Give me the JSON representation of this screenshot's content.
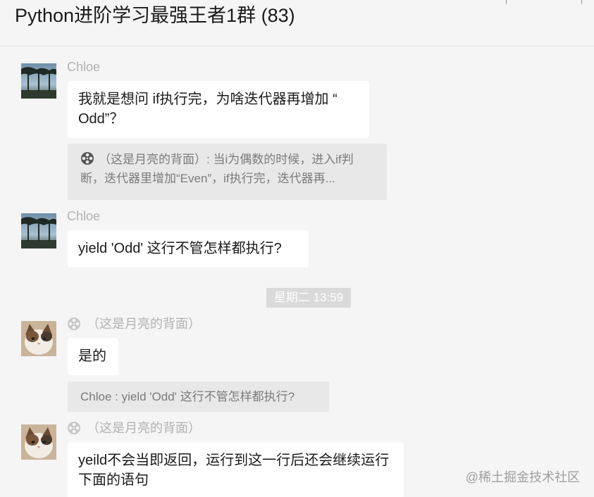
{
  "header": {
    "title": "Python进阶学习最强王者1群 (83)"
  },
  "messages": [
    {
      "sender": "Chloe",
      "text": "我就是想问 if执行完，为啥迭代器再增加 “ Odd”？",
      "quote": "（这是月亮的背面）: 当i为偶数的时候，进入if判断，迭代器里增加“Even”，if执行完，迭代器再..."
    },
    {
      "sender": "Chloe",
      "text": "yield 'Odd' 这行不管怎样都执行?"
    },
    {
      "sender": "（这是月亮的背面）",
      "text": "是的",
      "quote": "Chloe : yield 'Odd' 这行不管怎样都执行?"
    },
    {
      "sender": "（这是月亮的背面）",
      "text": "yeild不会当即返回，运行到这一行后还会继续运行下面的语句"
    }
  ],
  "timestamp": "星期二 13:59",
  "watermark": "@稀土掘金技术社区",
  "icons": {
    "avatar_chloe": "tree-landscape-avatar",
    "avatar_moon": "cat-avatar",
    "sender_badge": "film-reel-icon"
  },
  "colors": {
    "background": "#f5f5f5",
    "bubble": "#ffffff",
    "quote": "#e8e8e8",
    "sender_text": "#b2b2b2",
    "timestamp_bg": "#dadada"
  }
}
